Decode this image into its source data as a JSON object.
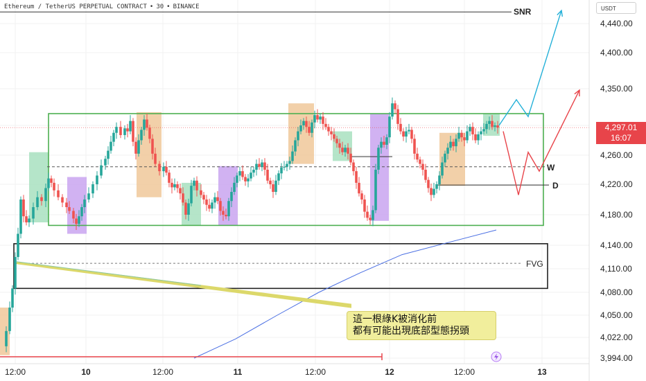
{
  "header": {
    "symbol": "Ethereum / TetherUS PERPETUAL CONTRACT",
    "sep1": "•",
    "interval": "30",
    "sep2": "•",
    "exchange": "BINANCE"
  },
  "unit_label": "USDT",
  "last_price": {
    "value": "4,297.01",
    "countdown": "16:07",
    "color": "#e8444a"
  },
  "annotations": {
    "snr": "SNR",
    "w": "W",
    "d": "D",
    "fvg": "FVG",
    "callout_line1": "這一根綠K被消化前",
    "callout_line2": "都有可能出現底部型態拐頭"
  },
  "colors": {
    "up": "#26a69a",
    "down": "#ef5350",
    "range_box": "#4caf50",
    "orange_zone": "#f0c89a",
    "green_zone": "#a8e0bf",
    "purple_zone": "#c9a4f0",
    "projection_up": "#23b0d8",
    "projection_down": "#e8444a",
    "ma": "#4a6fe3"
  },
  "chart_data": {
    "type": "candlestick",
    "title": "Ethereum / TetherUS PERPETUAL CONTRACT • 30 • BINANCE",
    "y_unit": "USDT",
    "y_ticks": [
      3994,
      4022,
      4050,
      4080,
      4110,
      4140,
      4180,
      4220,
      4260,
      4300,
      4350,
      4400,
      4440
    ],
    "y_tick_labels": [
      "3,994.00",
      "4,022.00",
      "4,050.00",
      "4,080.00",
      "4,110.00",
      "4,140.00",
      "4,180.00",
      "4,220.00",
      "4,260.00",
      "4,300.00",
      "4,350.00",
      "4,400.00",
      "4,440.00"
    ],
    "x_tick_labels": [
      "12:00",
      "10",
      "12:00",
      "11",
      "12:00",
      "12",
      "12:00",
      "13"
    ],
    "levels": [
      {
        "name": "SNR",
        "price": 4456
      },
      {
        "name": "W",
        "price": 4244
      },
      {
        "name": "D",
        "price": 4219
      },
      {
        "name": "FVG",
        "price": 4117
      }
    ],
    "range_box": {
      "top": 4316,
      "bottom": 4166
    },
    "fvg_box": {
      "top": 4142,
      "bottom": 4085
    },
    "last_price": 4297.01,
    "price_path": [
      [
        0,
        4010
      ],
      [
        5,
        4030
      ],
      [
        10,
        4060
      ],
      [
        14,
        4085
      ],
      [
        18,
        4125
      ],
      [
        22,
        4155
      ],
      [
        26,
        4200
      ],
      [
        30,
        4178
      ],
      [
        34,
        4170
      ],
      [
        38,
        4175
      ],
      [
        44,
        4190
      ],
      [
        50,
        4203
      ],
      [
        56,
        4198
      ],
      [
        62,
        4215
      ],
      [
        66,
        4228
      ],
      [
        70,
        4222
      ],
      [
        74,
        4212
      ],
      [
        80,
        4203
      ],
      [
        86,
        4196
      ],
      [
        92,
        4190
      ],
      [
        96,
        4185
      ],
      [
        102,
        4175
      ],
      [
        106,
        4168
      ],
      [
        110,
        4178
      ],
      [
        114,
        4190
      ],
      [
        118,
        4200
      ],
      [
        124,
        4208
      ],
      [
        130,
        4220
      ],
      [
        136,
        4232
      ],
      [
        142,
        4246
      ],
      [
        148,
        4255
      ],
      [
        152,
        4266
      ],
      [
        156,
        4278
      ],
      [
        160,
        4290
      ],
      [
        164,
        4298
      ],
      [
        170,
        4287
      ],
      [
        176,
        4296
      ],
      [
        180,
        4292
      ],
      [
        184,
        4306
      ],
      [
        188,
        4278
      ],
      [
        192,
        4262
      ],
      [
        196,
        4280
      ],
      [
        200,
        4294
      ],
      [
        204,
        4308
      ],
      [
        208,
        4297
      ],
      [
        212,
        4282
      ],
      [
        216,
        4262
      ],
      [
        220,
        4248
      ],
      [
        226,
        4238
      ],
      [
        232,
        4244
      ],
      [
        236,
        4236
      ],
      [
        240,
        4222
      ],
      [
        244,
        4216
      ],
      [
        248,
        4220
      ],
      [
        252,
        4215
      ],
      [
        256,
        4208
      ],
      [
        260,
        4196
      ],
      [
        264,
        4180
      ],
      [
        268,
        4195
      ],
      [
        272,
        4218
      ],
      [
        276,
        4225
      ],
      [
        280,
        4212
      ],
      [
        286,
        4206
      ],
      [
        290,
        4200
      ],
      [
        294,
        4193
      ],
      [
        298,
        4188
      ],
      [
        302,
        4196
      ],
      [
        306,
        4203
      ],
      [
        310,
        4198
      ],
      [
        314,
        4185
      ],
      [
        318,
        4180
      ],
      [
        322,
        4178
      ],
      [
        326,
        4198
      ],
      [
        330,
        4210
      ],
      [
        334,
        4222
      ],
      [
        338,
        4232
      ],
      [
        342,
        4238
      ],
      [
        346,
        4230
      ],
      [
        350,
        4224
      ],
      [
        354,
        4228
      ],
      [
        358,
        4236
      ],
      [
        362,
        4240
      ],
      [
        366,
        4248
      ],
      [
        370,
        4244
      ],
      [
        374,
        4250
      ],
      [
        378,
        4240
      ],
      [
        382,
        4225
      ],
      [
        386,
        4220
      ],
      [
        390,
        4210
      ],
      [
        394,
        4225
      ],
      [
        398,
        4235
      ],
      [
        402,
        4243
      ],
      [
        406,
        4244
      ],
      [
        410,
        4248
      ],
      [
        414,
        4252
      ],
      [
        418,
        4265
      ],
      [
        422,
        4280
      ],
      [
        426,
        4292
      ],
      [
        430,
        4300
      ],
      [
        434,
        4306
      ],
      [
        438,
        4298
      ],
      [
        442,
        4290
      ],
      [
        446,
        4304
      ],
      [
        450,
        4314
      ],
      [
        454,
        4308
      ],
      [
        458,
        4312
      ],
      [
        462,
        4302
      ],
      [
        466,
        4298
      ],
      [
        470,
        4292
      ],
      [
        474,
        4288
      ],
      [
        478,
        4282
      ],
      [
        482,
        4276
      ],
      [
        486,
        4270
      ],
      [
        490,
        4264
      ],
      [
        494,
        4270
      ],
      [
        498,
        4262
      ],
      [
        502,
        4250
      ],
      [
        506,
        4238
      ],
      [
        510,
        4222
      ],
      [
        514,
        4208
      ],
      [
        518,
        4200
      ],
      [
        522,
        4184
      ],
      [
        526,
        4176
      ],
      [
        530,
        4173
      ],
      [
        534,
        4186
      ],
      [
        538,
        4240
      ],
      [
        542,
        4270
      ],
      [
        546,
        4278
      ],
      [
        550,
        4274
      ],
      [
        554,
        4284
      ],
      [
        558,
        4312
      ],
      [
        562,
        4330
      ],
      [
        566,
        4322
      ],
      [
        570,
        4302
      ],
      [
        574,
        4292
      ],
      [
        578,
        4285
      ],
      [
        582,
        4292
      ],
      [
        586,
        4294
      ],
      [
        590,
        4282
      ],
      [
        594,
        4262
      ],
      [
        598,
        4254
      ],
      [
        602,
        4248
      ],
      [
        606,
        4240
      ],
      [
        610,
        4226
      ],
      [
        614,
        4215
      ],
      [
        618,
        4206
      ],
      [
        622,
        4214
      ],
      [
        626,
        4220
      ],
      [
        630,
        4232
      ],
      [
        634,
        4250
      ],
      [
        638,
        4262
      ],
      [
        642,
        4270
      ],
      [
        646,
        4278
      ],
      [
        650,
        4272
      ],
      [
        654,
        4282
      ],
      [
        658,
        4290
      ],
      [
        662,
        4284
      ],
      [
        666,
        4280
      ],
      [
        670,
        4292
      ],
      [
        674,
        4298
      ],
      [
        678,
        4288
      ],
      [
        682,
        4280
      ],
      [
        686,
        4288
      ],
      [
        690,
        4292
      ],
      [
        694,
        4295
      ],
      [
        698,
        4302
      ],
      [
        702,
        4306
      ],
      [
        706,
        4298
      ],
      [
        710,
        4300
      ],
      [
        714,
        4297
      ]
    ],
    "projections": [
      {
        "name": "bullish",
        "points": [
          [
            720,
            4300
          ],
          [
            745,
            4335
          ],
          [
            762,
            4312
          ],
          [
            810,
            4458
          ]
        ]
      },
      {
        "name": "bearish",
        "points": [
          [
            726,
            4292
          ],
          [
            748,
            4206
          ],
          [
            762,
            4264
          ],
          [
            778,
            4238
          ],
          [
            836,
            4348
          ]
        ]
      }
    ],
    "moving_average": [
      [
        280,
        3994
      ],
      [
        340,
        4020
      ],
      [
        400,
        4050
      ],
      [
        460,
        4080
      ],
      [
        520,
        4105
      ],
      [
        580,
        4128
      ],
      [
        640,
        4142
      ],
      [
        716,
        4160
      ]
    ]
  }
}
